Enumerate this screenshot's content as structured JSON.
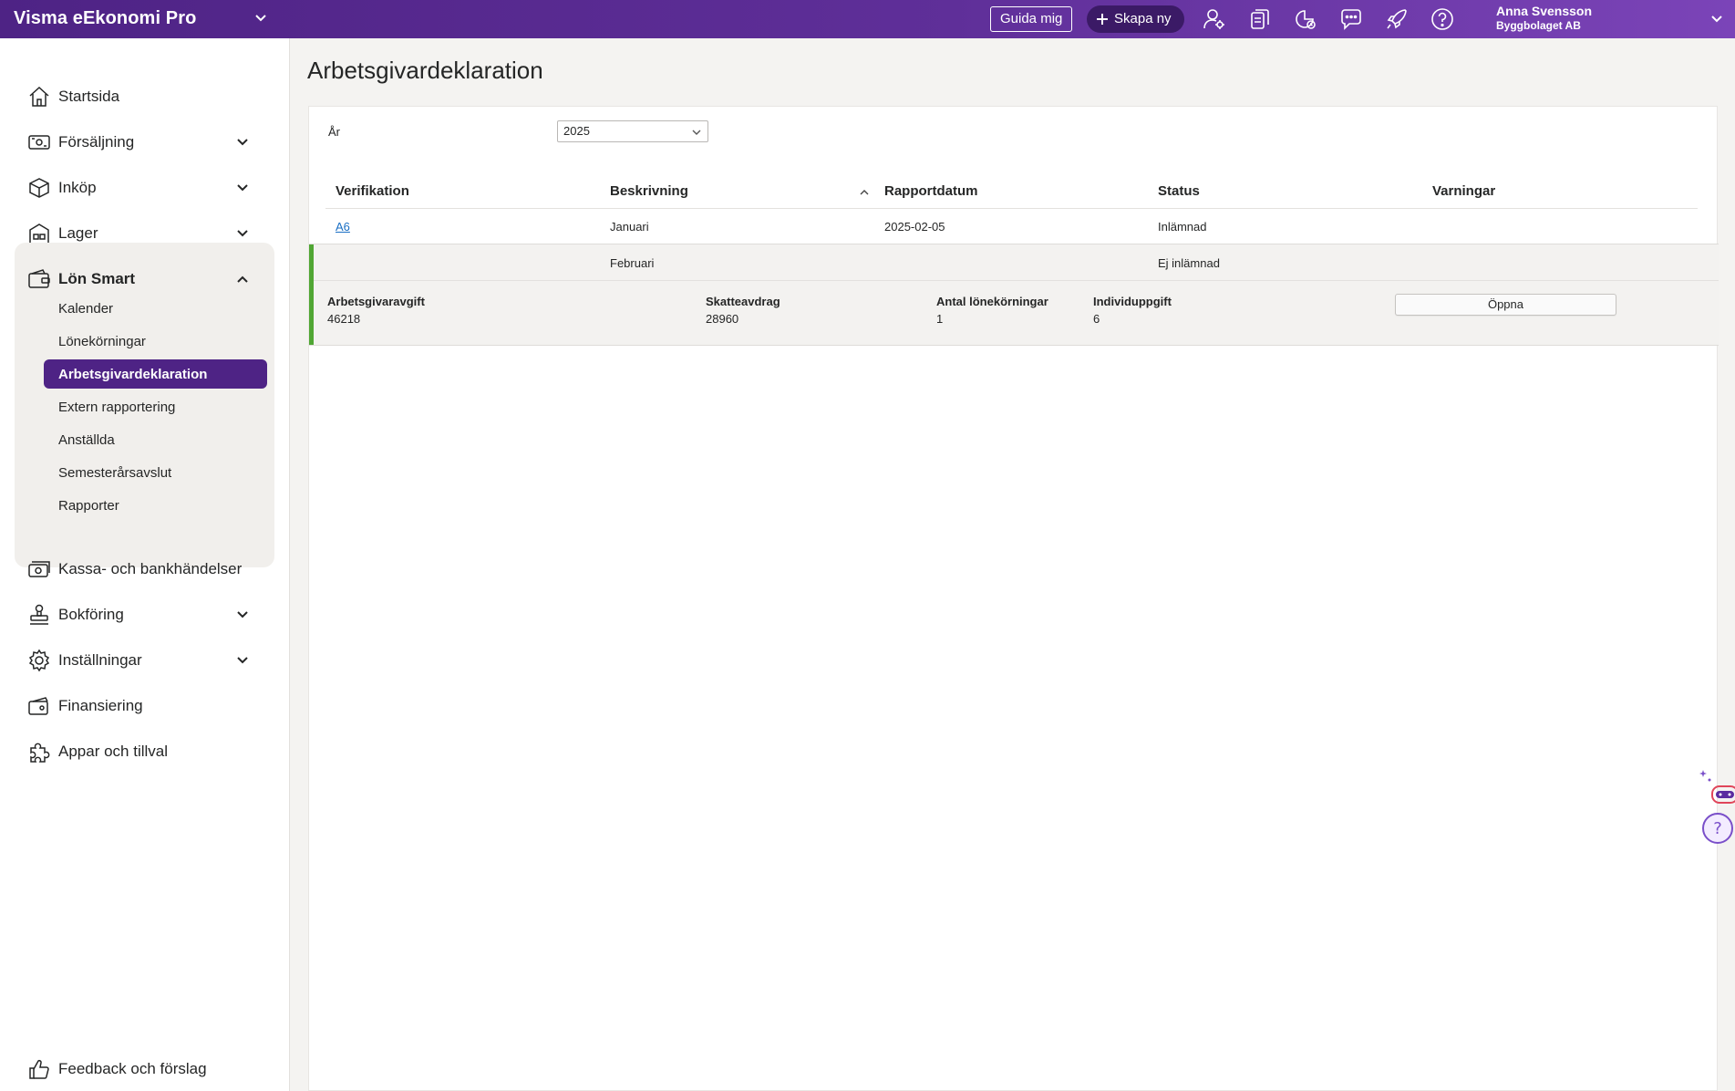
{
  "topbar": {
    "app_title": "Visma eEkonomi Pro",
    "guide_label": "Guida mig",
    "create_label": "Skapa ny",
    "user_name": "Anna Svensson",
    "user_company": "Byggbolaget AB",
    "icons": [
      "person-settings-icon",
      "documents-icon",
      "chart-clock-icon",
      "chat-icon",
      "rocket-icon",
      "help-icon"
    ]
  },
  "sidebar": {
    "items": [
      {
        "label": "Startsida",
        "icon": "home-icon"
      },
      {
        "label": "Försäljning",
        "icon": "sales-icon"
      },
      {
        "label": "Inköp",
        "icon": "purchase-icon"
      },
      {
        "label": "Lager",
        "icon": "warehouse-icon"
      },
      {
        "label": "Lön Smart",
        "icon": "wallet-icon"
      },
      {
        "label": "Kassa- och bankhändelser",
        "icon": "cash-icon"
      },
      {
        "label": "Bokföring",
        "icon": "stamp-icon"
      },
      {
        "label": "Inställningar",
        "icon": "gear-icon"
      },
      {
        "label": "Finansiering",
        "icon": "card-icon"
      },
      {
        "label": "Appar och tillval",
        "icon": "puzzle-icon"
      }
    ],
    "sub_items": [
      "Kalender",
      "Lönekörningar",
      "Arbetsgivardeklaration",
      "Extern rapportering",
      "Anställda",
      "Semesterårsavslut",
      "Rapporter"
    ],
    "feedback_label": "Feedback och förslag"
  },
  "main": {
    "title": "Arbetsgivardeklaration",
    "year_label": "År",
    "year_value": "2025",
    "columns": [
      "Verifikation",
      "Beskrivning",
      "Rapportdatum",
      "Status",
      "Varningar"
    ],
    "rows": [
      {
        "verifikation": "A6",
        "beskrivning": "Januari",
        "rapportdatum": "2025-02-05",
        "status": "Inlämnad",
        "varningar": ""
      },
      {
        "verifikation": "",
        "beskrivning": "Februari",
        "rapportdatum": "",
        "status": "Ej inlämnad",
        "varningar": ""
      }
    ],
    "details": {
      "arbetsgivaravgift_label": "Arbetsgivaravgift",
      "arbetsgivaravgift_value": "46218",
      "skatteavdrag_label": "Skatteavdrag",
      "skatteavdrag_value": "28960",
      "lonekorningar_label": "Antal lönekörningar",
      "lonekorningar_value": "1",
      "individuppgift_label": "Individuppgift",
      "individuppgift_value": "6",
      "open_label": "Öppna"
    }
  },
  "colors": {
    "brand_purple": "#4e2385",
    "accent_green": "#50a634",
    "link_blue": "#1a6fc4"
  }
}
